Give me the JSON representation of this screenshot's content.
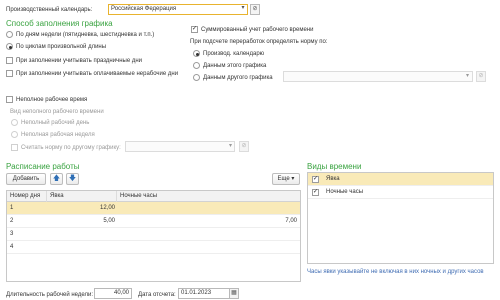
{
  "calendar": {
    "label": "Производственный календарь:",
    "value": "Российская Федерация",
    "dropdown_icon": "chevron-down-icon",
    "open_icon": "open-link-icon"
  },
  "fill_method": {
    "title": "Способ заполнения графика",
    "options": [
      {
        "label": "По дням недели (пятидневка, шестидневка и т.п.)",
        "selected": false
      },
      {
        "label": "По циклам произвольной длины",
        "selected": true
      }
    ],
    "checkboxes": [
      {
        "label": "При заполнении учитывать праздничные дни",
        "checked": false
      },
      {
        "label": "При заполнении учитывать оплачиваемые нерабочие дни",
        "checked": false
      }
    ]
  },
  "summary": {
    "checkbox_label": "Суммированный учет рабочего времени",
    "checked": true,
    "norm_label": "При подсчете переработок определять норму по:",
    "options": [
      {
        "label": "Производ. календарю",
        "selected": true
      },
      {
        "label": "Данным этого графика",
        "selected": false
      },
      {
        "label": "Данным другого графика",
        "selected": false
      }
    ],
    "other_value": ""
  },
  "part_time": {
    "checkbox_label": "Неполное рабочее время",
    "checked": false,
    "kind_label": "Вид неполного рабочего времени",
    "options": [
      {
        "label": "Неполный рабочий день"
      },
      {
        "label": "Неполная рабочая неделя"
      }
    ],
    "norm_checkbox_label": "Считать норму по другому графику:",
    "norm_value": ""
  },
  "schedule": {
    "title": "Расписание работы",
    "add_label": "Добавить",
    "up_icon": "arrow-up-icon",
    "down_icon": "arrow-down-icon",
    "more_label": "Еще",
    "columns": [
      "Номер дня",
      "Явка",
      "Ночные часы"
    ],
    "rows": [
      {
        "day": "1",
        "attendance": "12,00",
        "night": ""
      },
      {
        "day": "2",
        "attendance": "5,00",
        "night": "7,00"
      },
      {
        "day": "3",
        "attendance": "",
        "night": ""
      },
      {
        "day": "4",
        "attendance": "",
        "night": ""
      }
    ],
    "selected_row": 0
  },
  "time_types": {
    "title": "Виды времени",
    "items": [
      {
        "label": "Явка",
        "checked": true
      },
      {
        "label": "Ночные часы",
        "checked": true
      }
    ],
    "note": "Часы явки указывайте не включая в них ночных и других часов"
  },
  "footer": {
    "week_hours_label": "Длительность рабочей недели:",
    "week_hours_value": "40,00",
    "report_date_label": "Дата отсчета:",
    "report_date_value": "01.01.2023",
    "calendar_icon": "calendar-icon"
  }
}
